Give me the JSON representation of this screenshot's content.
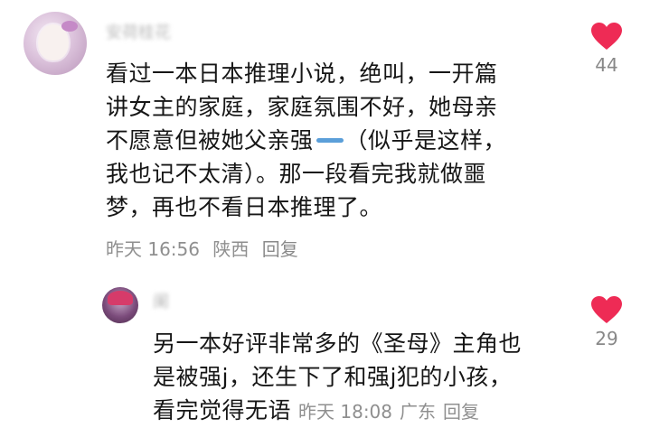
{
  "comment": {
    "username": "安荷桂花",
    "lines": [
      "看过一本日本推理小说，绝叫，一开篇",
      "讲女主的家庭，家庭氛围不好，她母亲",
      "不愿意但被她父亲强",
      "（似乎是这样，",
      "我也记不太清）。那一段看完我就做噩",
      "梦，再也不看日本推理了。"
    ],
    "time": "昨天 16:56",
    "location": "陕西",
    "reply_label": "回复",
    "likes": "44"
  },
  "reply": {
    "username": "阑",
    "lines": [
      "另一本好评非常多的《圣母》主角也",
      "是被强j，还生下了和强j犯的小孩，",
      "看完觉得无语"
    ],
    "time": "昨天 18:08",
    "location": "广东",
    "reply_label": "回复",
    "likes": "29"
  },
  "colors": {
    "heart": "#ee2b55",
    "masked_dash": "#5b9fd9",
    "meta": "#8f8f8f"
  },
  "icons": {
    "like": "heart-icon",
    "masked_word": "blue-dash-redaction"
  }
}
